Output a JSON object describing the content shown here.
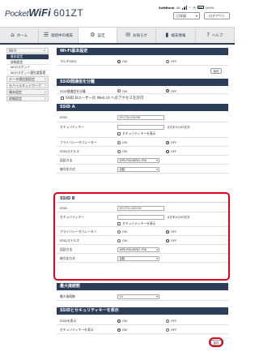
{
  "header": {
    "logo_prefix": "Pocket",
    "logo_wifi": "WiFi",
    "logo_model": "601ZT",
    "carrier": "SoftBank",
    "network": "4G",
    "battery": "100%",
    "language": "日本語",
    "logout": "ログアウト"
  },
  "nav": [
    {
      "icon": "⌂",
      "label": "ホーム"
    },
    {
      "icon": "☰",
      "label": "接続中の端末"
    },
    {
      "icon": "⚙",
      "label": "設定"
    },
    {
      "icon": "✉",
      "label": "お知らせ"
    },
    {
      "icon": "▮",
      "label": "端末情報"
    },
    {
      "icon": "?",
      "label": "ヘルプ"
    }
  ],
  "sidebar": {
    "wifi": "Wi-Fi",
    "items": [
      "基本設定",
      "詳細設定",
      "Wi-Fiスポット",
      "Wi-Fiスポット優先度管理"
    ],
    "data": "データ通信量設定",
    "mobile": "モバイルネットワーク",
    "system": "端末設定",
    "advanced": "詳細設定"
  },
  "main": {
    "basic_title": "Wi-Fi基本設定",
    "multi_ssid": "マルチSSID",
    "on": "ON",
    "off": "OFF",
    "save": "保存",
    "sep_title": "SSID間通信を分離",
    "sep_label": "SSID間通信を分離",
    "sep_check": "SSID Bユーザーの Web UI へのアクセスを許可",
    "ssida_title": "SSID A",
    "ssid_label": "SSID",
    "ssida_value": "601ZTa-0080f8",
    "key_label": "セキュリティキー",
    "key_hint": "8文字から63文字",
    "show_key": "セキュリティキーを表示",
    "privacy": "プライバシーセパレーター",
    "stealth": "SSIDステルス",
    "auth": "認証方法",
    "auth_value": "WPA-PSK/WPA2-PSK",
    "enc": "暗号化方式",
    "enc_value": "自動",
    "ssidb_title": "SSID B",
    "ssidb_value": "601ZTb-000058",
    "max_title": "最大接続数",
    "max_label": "最大接続数",
    "max_value": "10",
    "show_title": "SSIDとセキュリティキーを表示",
    "show_ssid": "SSIDを表示",
    "show_sec": "セキュリティキーを表示"
  }
}
